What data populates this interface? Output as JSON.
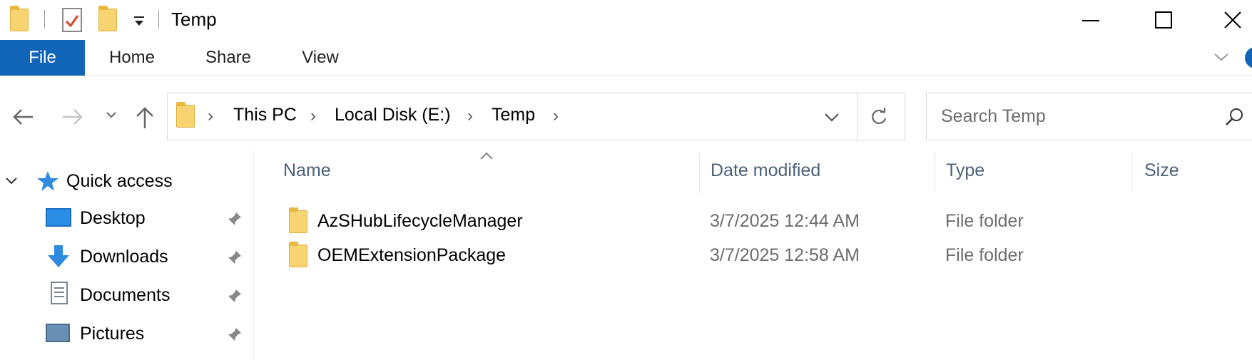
{
  "window": {
    "title": "Temp"
  },
  "ribbon": {
    "tabs": [
      "File",
      "Home",
      "Share",
      "View"
    ]
  },
  "address": {
    "crumbs": [
      "This PC",
      "Local Disk (E:)",
      "Temp"
    ]
  },
  "search": {
    "placeholder": "Search Temp"
  },
  "columns": [
    "Name",
    "Date modified",
    "Type",
    "Size"
  ],
  "files": [
    {
      "name": "AzSHubLifecycleManager",
      "date": "3/7/2025 12:44 AM",
      "type": "File folder"
    },
    {
      "name": "OEMExtensionPackage",
      "date": "3/7/2025 12:58 AM",
      "type": "File folder"
    }
  ],
  "navpane": {
    "quick_access": "Quick access",
    "items": [
      "Desktop",
      "Downloads",
      "Documents",
      "Pictures"
    ]
  },
  "colors": {
    "accent": "#1165b8",
    "folder": "#f8d372",
    "header_text": "#4c607a"
  },
  "icons": [
    "folder-icon",
    "properties-icon",
    "dropdown-icon",
    "minimize-icon",
    "maximize-icon",
    "close-icon",
    "back-icon",
    "forward-icon",
    "recent-icon",
    "up-icon",
    "refresh-icon",
    "search-icon",
    "star-icon",
    "desktop-icon",
    "downloads-icon",
    "documents-icon",
    "pictures-icon",
    "pin-icon"
  ]
}
